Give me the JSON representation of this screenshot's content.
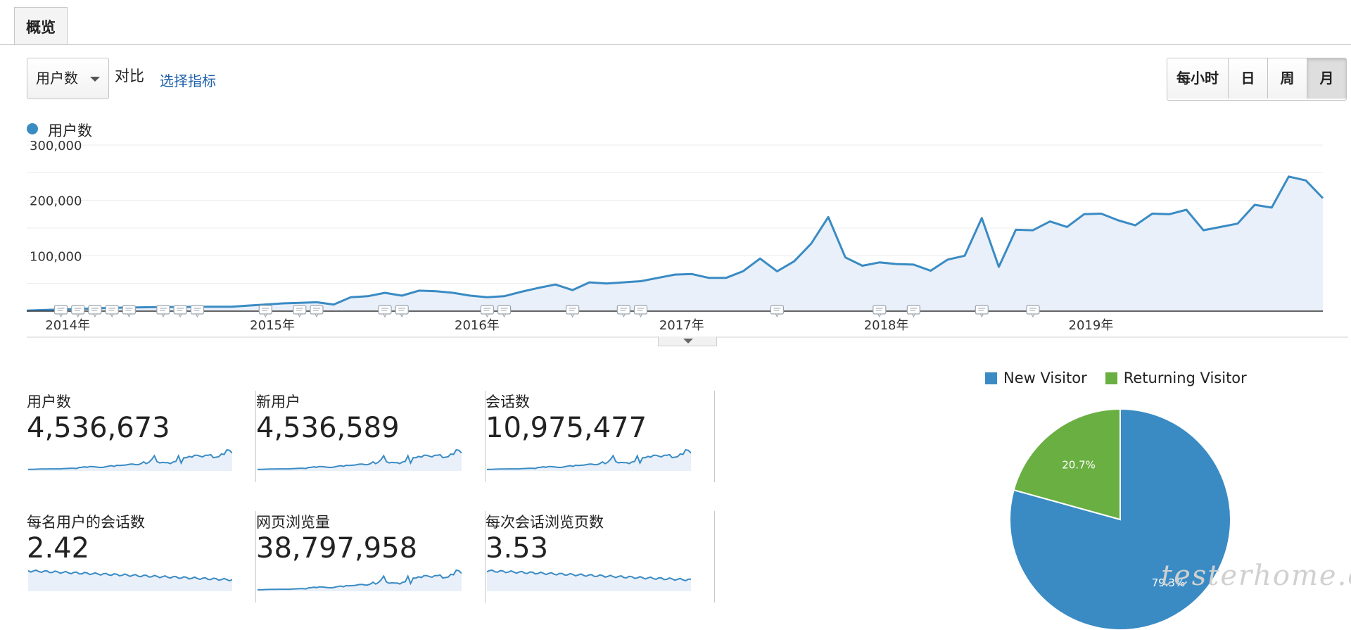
{
  "tabs": [
    {
      "label": "概览"
    }
  ],
  "toolbar": {
    "metric_select": "用户数",
    "compare_label": "对比",
    "choose_metric_link": "选择指标",
    "granularity": [
      {
        "label": "每小时",
        "active": false
      },
      {
        "label": "日",
        "active": false
      },
      {
        "label": "周",
        "active": false
      },
      {
        "label": "月",
        "active": true
      }
    ]
  },
  "colors": {
    "accent": "#3a8bc4",
    "area_fill": "#e9f0f9",
    "new_visitor": "#3a8bc4",
    "returning_visitor": "#6aaf42",
    "link": "#1a5ea8"
  },
  "icons": {
    "annotation_marker": "comment-icon",
    "metric_dropdown": "chevron-down-icon",
    "chart_expander": "chevron-down-icon"
  },
  "chart_data": [
    {
      "type": "area",
      "series": [
        {
          "name": "用户数",
          "x": [
            "2013-12",
            "2014-01",
            "2014-02",
            "2014-03",
            "2014-04",
            "2014-05",
            "2014-06",
            "2014-07",
            "2014-08",
            "2014-09",
            "2014-10",
            "2014-11",
            "2014-12",
            "2015-01",
            "2015-02",
            "2015-03",
            "2015-04",
            "2015-05",
            "2015-06",
            "2015-07",
            "2015-08",
            "2015-09",
            "2015-10",
            "2015-11",
            "2015-12",
            "2016-01",
            "2016-02",
            "2016-03",
            "2016-04",
            "2016-05",
            "2016-06",
            "2016-07",
            "2016-08",
            "2016-09",
            "2016-10",
            "2016-11",
            "2016-12",
            "2017-01",
            "2017-02",
            "2017-03",
            "2017-04",
            "2017-05",
            "2017-06",
            "2017-07",
            "2017-08",
            "2017-09",
            "2017-10",
            "2017-11",
            "2017-12",
            "2018-01",
            "2018-02",
            "2018-03",
            "2018-04",
            "2018-05",
            "2018-06",
            "2018-07",
            "2018-08",
            "2018-09",
            "2018-10",
            "2018-11",
            "2018-12",
            "2019-01",
            "2019-02",
            "2019-03",
            "2019-04",
            "2019-05",
            "2019-06",
            "2019-07",
            "2019-08",
            "2019-09",
            "2019-10"
          ],
          "values": [
            1000,
            2000,
            3000,
            4000,
            5000,
            6000,
            6500,
            7000,
            7500,
            7500,
            8000,
            8000,
            8000,
            10000,
            12000,
            14000,
            15000,
            16000,
            12000,
            25000,
            27000,
            33000,
            28000,
            37000,
            36000,
            33000,
            28000,
            25000,
            27000,
            35000,
            42000,
            48000,
            38000,
            52000,
            50000,
            52000,
            54000,
            60000,
            66000,
            67000,
            60000,
            60000,
            72000,
            95000,
            72000,
            90000,
            122000,
            170000,
            97000,
            82000,
            88000,
            85000,
            84000,
            73000,
            93000,
            100000,
            168000,
            80000,
            147000,
            146000,
            162000,
            152000,
            175000,
            176000,
            164000,
            155000,
            176000,
            175000,
            183000,
            146000,
            152000
          ],
          "values_tail": [
            158000,
            192000,
            187000,
            243000,
            236000,
            204000
          ]
        }
      ],
      "x_ticks": [
        "2014年",
        "2015年",
        "2016年",
        "2017年",
        "2018年",
        "2019年"
      ],
      "y_ticks": [
        "300,000",
        "200,000",
        "100,000"
      ],
      "ylim": [
        0,
        300000
      ],
      "annotation_months": [
        "2014-02",
        "2014-03",
        "2014-04",
        "2014-05",
        "2014-06",
        "2014-08",
        "2014-09",
        "2014-10",
        "2015-02",
        "2015-04",
        "2015-05",
        "2015-09",
        "2015-10",
        "2016-03",
        "2016-04",
        "2016-08",
        "2016-11",
        "2016-12",
        "2017-08",
        "2018-02",
        "2018-04",
        "2018-08",
        "2018-11"
      ],
      "grid": true,
      "legend": "top-left"
    },
    {
      "type": "pie",
      "legend": "top",
      "slices": [
        {
          "name": "New Visitor",
          "value": 79.3,
          "label": "79.3%"
        },
        {
          "name": "Returning Visitor",
          "value": 20.7,
          "label": "20.7%"
        }
      ]
    }
  ],
  "metrics": [
    {
      "label": "用户数",
      "value": "4,536,673",
      "trend": "up"
    },
    {
      "label": "新用户",
      "value": "4,536,589",
      "trend": "up"
    },
    {
      "label": "会话数",
      "value": "10,975,477",
      "trend": "up"
    },
    {
      "label": "每名用户的会话数",
      "value": "2.42",
      "trend": "flat"
    },
    {
      "label": "网页浏览量",
      "value": "38,797,958",
      "trend": "up"
    },
    {
      "label": "每次会话浏览页数",
      "value": "3.53",
      "trend": "flat"
    }
  ],
  "pie_legend": [
    {
      "label": "New Visitor"
    },
    {
      "label": "Returning Visitor"
    }
  ],
  "watermark": "testerhome.com"
}
